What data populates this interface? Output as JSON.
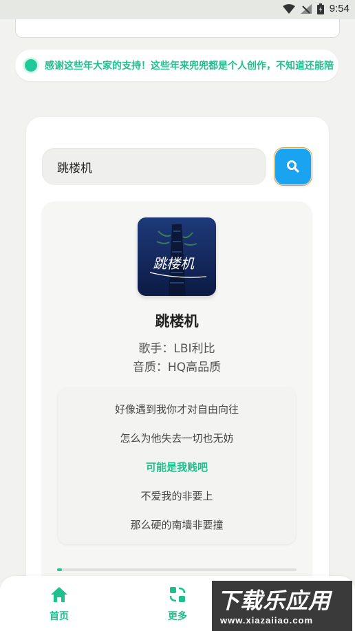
{
  "status_bar": {
    "time": "9:54"
  },
  "notice": {
    "text": "感谢这些年大家的支持！这些年来兜兜都是个人创作，不知道还能陪"
  },
  "search": {
    "value": "跳楼机"
  },
  "song": {
    "cover_text": "跳楼机",
    "title": "跳楼机",
    "singer": "歌手：LBI利比",
    "quality": "音质：HQ高品质",
    "progress": 0.005
  },
  "lyrics": [
    {
      "text": "好像遇到我你才对自由向往",
      "active": false
    },
    {
      "text": "怎么为他失去一切也无妨",
      "active": false
    },
    {
      "text": "可能是我贱吧",
      "active": true
    },
    {
      "text": "不爱我的非要上",
      "active": false
    },
    {
      "text": "那么硬的南墙非要撞",
      "active": false
    }
  ],
  "bottom_nav": {
    "home_label": "首页",
    "more_label": "更多"
  },
  "watermark": {
    "main": "下载乐应用",
    "url": "www.xiazaiiao.com"
  },
  "colors": {
    "accent": "#1fbf8e",
    "search_button": "#1aa3f0"
  }
}
